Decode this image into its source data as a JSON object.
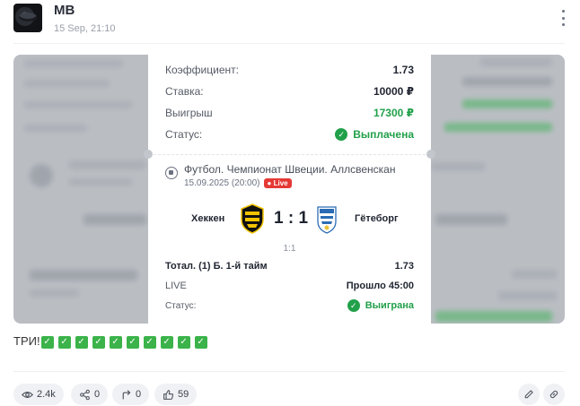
{
  "post": {
    "author": "MB",
    "date": "15 Sep, 21:10",
    "text": "ТРИ!",
    "check_emoji": "✅",
    "check_count": 10
  },
  "bet": {
    "odds_label": "Коэффициент:",
    "odds_value": "1.73",
    "stake_label": "Ставка:",
    "stake_value": "10000 ₽",
    "win_label": "Выигрыш",
    "win_value": "17300 ₽",
    "status_label": "Статус:",
    "status_value": "Выплачена",
    "event": {
      "league": "Футбол. Чемпионат Швеции. Аллсвенскан",
      "datetime": "15.09.2025 (20:00)",
      "live_badge": "Live",
      "home_team": "Хеккен",
      "away_team": "Гётеборг",
      "score": "1 : 1",
      "half_score": "1:1",
      "market": "Тотал. (1) Б. 1-й тайм",
      "market_odds": "1.73",
      "live_label": "LIVE",
      "elapsed": "Прошло 45:00",
      "status_label": "Статус:",
      "status_value": "Выиграна"
    }
  },
  "stats": {
    "views": "2.4k",
    "shares": "0",
    "reposts": "0",
    "likes": "59"
  },
  "icons": {
    "menu": "more-vertical-icon",
    "views": "eye-icon",
    "shares": "share-icon",
    "reposts": "repost-arrow-icon",
    "likes": "thumbs-up-icon",
    "edit": "pencil-icon",
    "link": "link-icon"
  },
  "colors": {
    "green": "#21a04a",
    "live_red": "#e53935",
    "pill_bg": "#f0f1f4"
  }
}
